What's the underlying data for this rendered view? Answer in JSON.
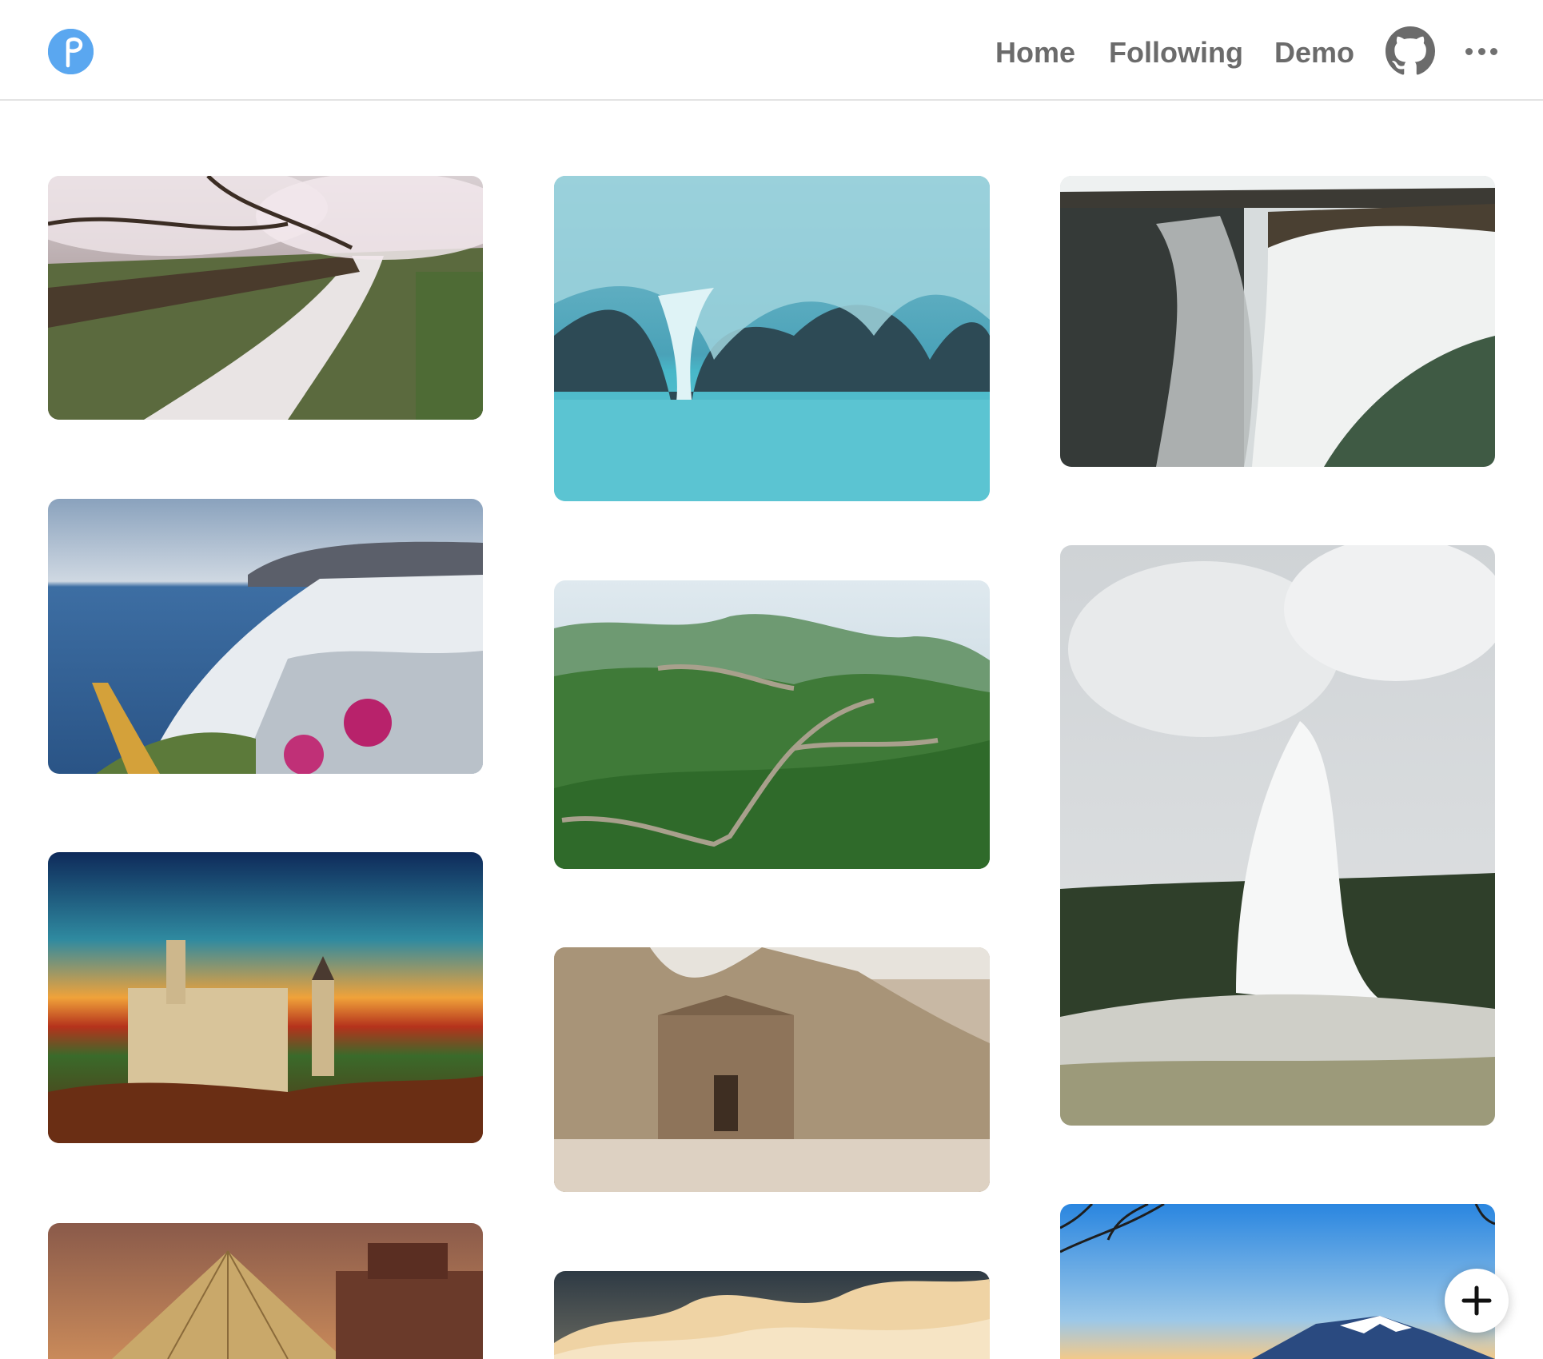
{
  "header": {
    "logo_icon": "pinterest-p-logo-icon",
    "logo_color": "#5aa7f0",
    "nav": {
      "home": "Home",
      "following": "Following",
      "demo": "Demo"
    },
    "github_icon": "github-icon",
    "more_icon": "more-horizontal-icon"
  },
  "feed": {
    "columns": [
      {
        "pins": [
          {
            "subject": "cherry-blossom-path"
          },
          {
            "subject": "santorini-village"
          },
          {
            "subject": "neuschwanstein-castle"
          },
          {
            "subject": "louvre-pyramid"
          }
        ]
      },
      {
        "pins": [
          {
            "subject": "marble-caves"
          },
          {
            "subject": "great-wall"
          },
          {
            "subject": "petra-monastery"
          },
          {
            "subject": "sea-of-clouds"
          }
        ]
      },
      {
        "pins": [
          {
            "subject": "waterfall"
          },
          {
            "subject": "geyser"
          },
          {
            "subject": "mount-fuji"
          }
        ]
      }
    ]
  },
  "fab": {
    "icon": "plus-icon"
  }
}
